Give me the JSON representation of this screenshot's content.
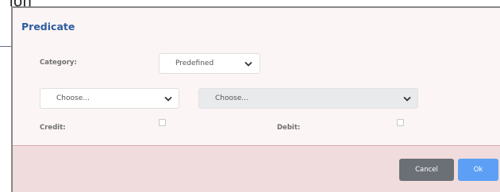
{
  "background": {
    "partial_text": "ion"
  },
  "dialog": {
    "title": "Predicate",
    "category_label": "Category:",
    "category_select": {
      "value": "Predefined"
    },
    "choose_left": {
      "value": "Choose..."
    },
    "choose_right": {
      "value": "Choose..."
    },
    "credit_label": "Credit:",
    "debit_label": "Debit:",
    "credit_checked": false,
    "debit_checked": false
  },
  "footer": {
    "cancel_label": "Cancel",
    "ok_label": "Ok"
  },
  "colors": {
    "title": "#2d5d9f",
    "cancel_button": "#6b6f76",
    "ok_button": "#5c9ff5",
    "dialog_body": "#fcf5f5",
    "footer": "#f0dcdc"
  },
  "icons": {
    "select_chevron": "chevron-down-icon"
  }
}
